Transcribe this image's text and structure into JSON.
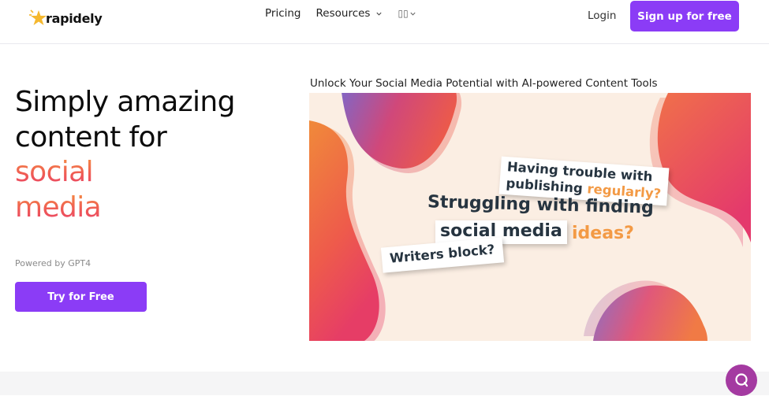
{
  "brand": {
    "name": "rapidely"
  },
  "nav": {
    "pricing": "Pricing",
    "resources": "Resources",
    "language": "▯▯"
  },
  "auth": {
    "login": "Login",
    "signup": "Sign up for free"
  },
  "hero": {
    "line1": "Simply amazing",
    "line2": "content for",
    "line3": "social",
    "line4": "media",
    "powered_by": "Powered by GPT4",
    "cta": "Try for Free"
  },
  "visual": {
    "caption": "Unlock Your Social Media Potential with AI-powered Content Tools",
    "card1_line1": "Having trouble with",
    "card1_line2a": "publishing",
    "card1_line2b": "regularly?",
    "big_line1": "Struggling with finding",
    "big_line2": "social media",
    "big_ideas": "ideas?",
    "card3": "Writers block?"
  },
  "colors": {
    "accent": "#8b3cf6",
    "gradient_orange": "#f5913f",
    "gradient_pink": "#ea3f6c",
    "chat": "#a43aa1"
  },
  "icons": [
    "star-logo-icon",
    "chevron-down-icon",
    "chat-bubble-icon"
  ]
}
